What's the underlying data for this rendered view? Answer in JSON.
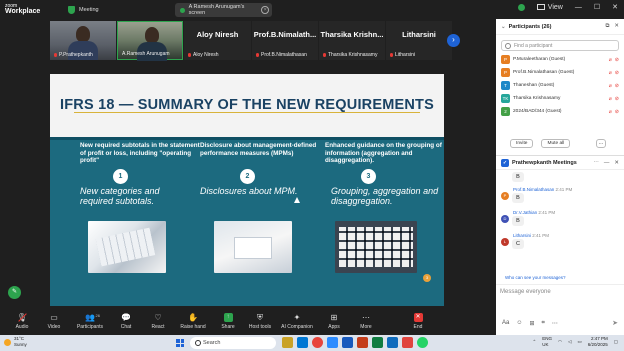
{
  "app": {
    "logo_line1": "zoom",
    "logo_line2": "Workplace"
  },
  "top": {
    "meeting_tab": "Meeting",
    "share_tab": "A Ramesh Arunugam's screen",
    "view_label": "View"
  },
  "strip": {
    "tiles": [
      {
        "name": "P.Prathepkanth"
      },
      {
        "name": "A.Ramesh Arunugam"
      },
      {
        "big": "Aloy Niresh",
        "name": "Aloy Niresh"
      },
      {
        "big": "Prof.B.Nimalath...",
        "name": "Prof.B.Nimalathasan"
      },
      {
        "big": "Tharsika  Krishn...",
        "name": "Tharsika Krishnasamy"
      },
      {
        "big": "Litharsini",
        "name": "Litharsini"
      }
    ]
  },
  "slide": {
    "title": "IFRS 18 — SUMMARY OF THE NEW REQUIREMENTS",
    "columns": [
      {
        "heading": "New required subtotals in the statement of profit or loss, including \"operating profit\"",
        "num": "1",
        "italic": "New categories and required subtotals."
      },
      {
        "heading": "Disclosure about management-defined performance measures (MPMs)",
        "num": "2",
        "italic": "Disclosures about MPM."
      },
      {
        "heading": "Enhanced guidance on the grouping of information (aggregation and disaggregation).",
        "num": "3",
        "italic": "Grouping, aggregation and disaggregation."
      }
    ],
    "page_number": "3"
  },
  "toolbar": {
    "items": [
      {
        "label": "Audio",
        "icon": "mic-icon"
      },
      {
        "label": "Video",
        "icon": "camera-icon"
      },
      {
        "label": "Participants",
        "icon": "people-icon",
        "badge": "26"
      },
      {
        "label": "Chat",
        "icon": "chat-icon"
      },
      {
        "label": "React",
        "icon": "heart-icon"
      },
      {
        "label": "Raise hand",
        "icon": "hand-icon"
      },
      {
        "label": "Share",
        "icon": "share-icon"
      },
      {
        "label": "Host tools",
        "icon": "shield-icon"
      },
      {
        "label": "AI Companion",
        "icon": "sparkle-icon"
      },
      {
        "label": "Apps",
        "icon": "apps-icon"
      },
      {
        "label": "More",
        "icon": "more-icon"
      },
      {
        "label": "End",
        "icon": "end-icon"
      }
    ]
  },
  "participants": {
    "title": "Participants (26)",
    "search_placeholder": "Find a participant",
    "list": [
      {
        "initial": "P",
        "name": "P.Muraleetharan (Guest)",
        "color": "#e67e22"
      },
      {
        "initial": "P",
        "name": "Prof.B.Nimalathasan (Guest)",
        "color": "#e67e22"
      },
      {
        "initial": "T",
        "name": "Thaneshan (Guest)",
        "color": "#1e88c8"
      },
      {
        "initial": "TK",
        "name": "Tharsika Krishnasamy",
        "color": "#26a69a"
      },
      {
        "initial": "2",
        "name": "2024/BAD/344 (Guest)",
        "color": "#43a047"
      }
    ],
    "invite_label": "Invite",
    "mute_all_label": "Mute all",
    "more_label": "..."
  },
  "chat": {
    "title": "Prathewpkanth Meetings",
    "messages": [
      {
        "initial": "B",
        "who": "",
        "time": "",
        "text": "B",
        "color": "#e67e22"
      },
      {
        "initial": "P",
        "who": "Prof.B.Nimalathasan",
        "time": "2:41 PM",
        "text": "B",
        "color": "#e67e22"
      },
      {
        "initial": "D",
        "who": "Dr.V.Jathian",
        "time": "2:41 PM",
        "text": "B",
        "color": "#3f51b5"
      },
      {
        "initial": "L",
        "who": "Litharsini",
        "time": "2:41 PM",
        "text": "C",
        "color": "#c0392b"
      }
    ],
    "who_can_see": "Who can see your messages?",
    "input_placeholder": "Message everyone"
  },
  "taskbar": {
    "weather_temp": "31°C",
    "weather_text": "Sunny",
    "search_placeholder": "Search",
    "lang": "ENG",
    "region": "UK",
    "time": "2:47 PM",
    "date": "6/20/2025"
  }
}
